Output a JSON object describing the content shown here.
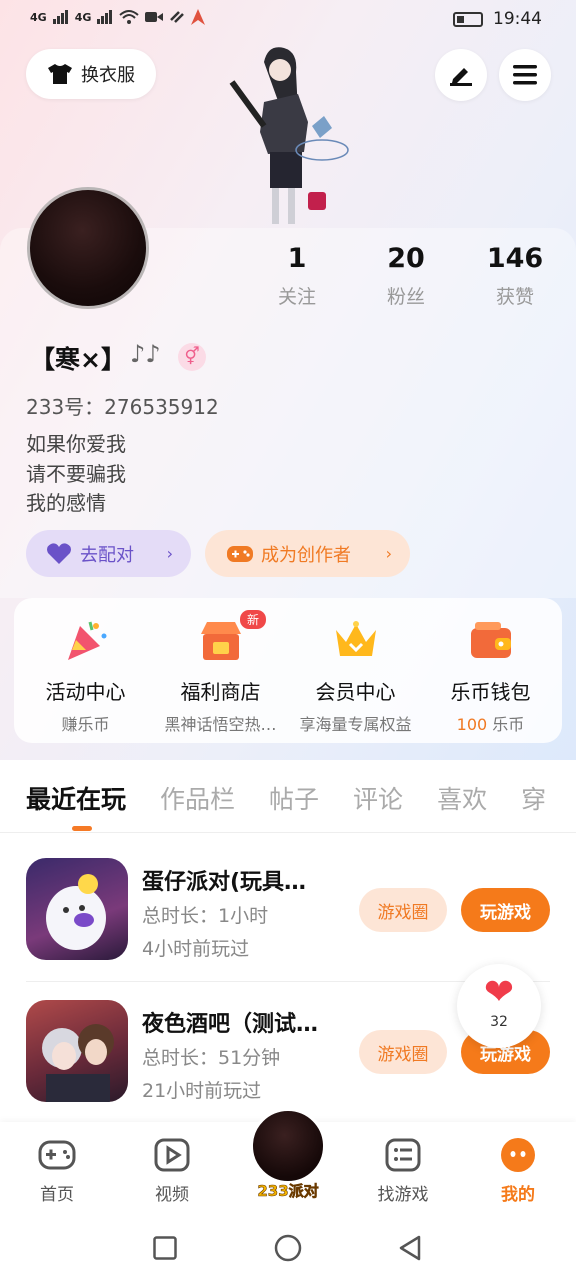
{
  "status": {
    "signal1": "4G",
    "signal2": "4G",
    "time": "19:44"
  },
  "header": {
    "wardrobe_label": "换衣服"
  },
  "profile": {
    "nickname": "【寒×】",
    "note_icon": "♪♪",
    "gender_symbol": "⚥",
    "uid": "233号：276535912",
    "bio": [
      "如果你爱我",
      "请不要骗我",
      "我的感情"
    ],
    "stats": [
      {
        "num": "1",
        "label": "关注"
      },
      {
        "num": "20",
        "label": "粉丝"
      },
      {
        "num": "146",
        "label": "获赞"
      }
    ],
    "match_label": "去配对",
    "creator_label": "成为创作者",
    "chevron": "›"
  },
  "features": [
    {
      "title": "活动中心",
      "sub": "赚乐币"
    },
    {
      "title": "福利商店",
      "sub": "黑神话悟空热…",
      "badge": "新"
    },
    {
      "title": "会员中心",
      "sub": "享海量专属权益"
    },
    {
      "title": "乐币钱包",
      "sub_amount": "100",
      "sub_unit": " 乐币"
    }
  ],
  "tabs": [
    "最近在玩",
    "作品栏",
    "帖子",
    "评论",
    "喜欢",
    "穿"
  ],
  "games": [
    {
      "title": "蛋仔派对(玩具…",
      "duration": "总时长：1小时",
      "last": "4小时前玩过",
      "circle": "游戏圈",
      "play": "玩游戏"
    },
    {
      "title": "夜色酒吧（测试…",
      "duration": "总时长：51分钟",
      "last": "21小时前玩过",
      "circle": "游戏圈",
      "play": "玩游戏"
    }
  ],
  "like_float": {
    "count": "32"
  },
  "nav": {
    "home": "首页",
    "video": "视频",
    "center": "233派对",
    "find": "找游戏",
    "mine": "我的"
  },
  "colors": {
    "accent": "#f57a1a",
    "purple": "#6a52c8",
    "pink": "#ef5e8c"
  }
}
